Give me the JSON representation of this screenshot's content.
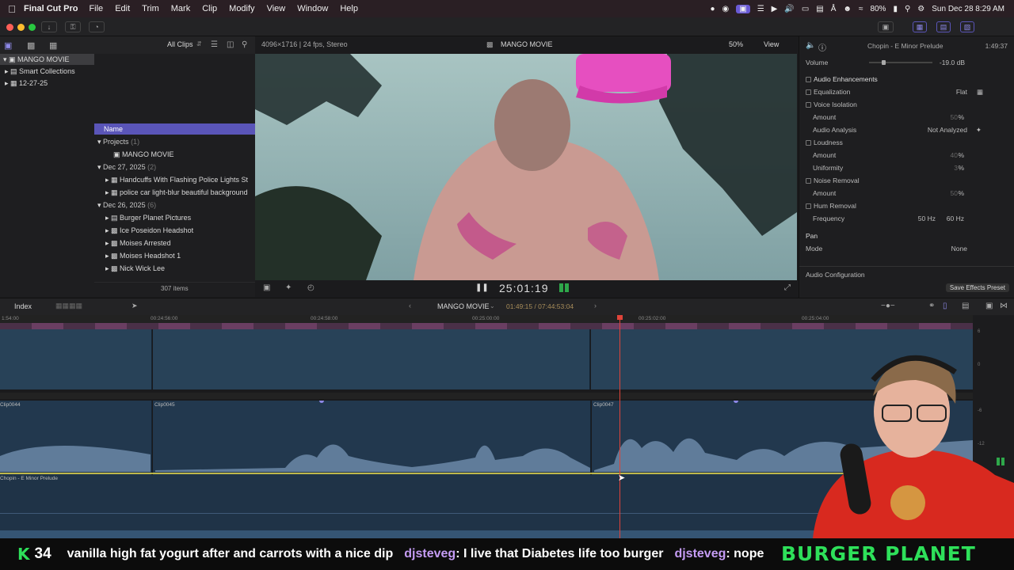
{
  "menubar": {
    "app_name": "Final Cut Pro",
    "items": [
      "File",
      "Edit",
      "Trim",
      "Mark",
      "Clip",
      "Modify",
      "View",
      "Window",
      "Help"
    ],
    "battery": "80%",
    "datetime": "Sun Dec 28  8:29 AM"
  },
  "browser": {
    "library_name": "MANGO MOVIE",
    "sidebar_items": [
      "Smart Collections",
      "12-27-25"
    ],
    "filter_label": "All Clips",
    "column_name": "Name",
    "items_count": "307 items",
    "groups": [
      {
        "label": "Projects",
        "count": "(1)",
        "items": [
          "MANGO MOVIE"
        ]
      },
      {
        "label": "Dec 27, 2025",
        "count": "(2)",
        "items": [
          "Handcuffs With Flashing Police Lights St",
          "police car light-blur beautiful background"
        ]
      },
      {
        "label": "Dec 26, 2025",
        "count": "(6)",
        "items": [
          "Burger Planet Pictures",
          "Ice Poseidon Headshot",
          "Moises Arrested",
          "Moises Headshot 1",
          "Nick Wick Lee"
        ]
      }
    ]
  },
  "viewer": {
    "format_info": "4096×1716 | 24 fps, Stereo",
    "title": "MANGO MOVIE",
    "zoom": "50%",
    "view_label": "View",
    "timecode": "25:01:19"
  },
  "inspector": {
    "clip_title": "Chopin - E Minor Prelude",
    "duration": "1:49:37",
    "volume_label": "Volume",
    "volume_value": "-19.0 dB",
    "section_enhancements": "Audio Enhancements",
    "equalization_label": "Equalization",
    "equalization_value": "Flat",
    "voice_isolation_label": "Voice Isolation",
    "amount_label": "Amount",
    "pct": "%",
    "amount1": "50",
    "audio_analysis_label": "Audio Analysis",
    "audio_analysis_value": "Not Analyzed",
    "loudness_label": "Loudness",
    "amount2": "40",
    "uniformity_label": "Uniformity",
    "uniformity_value": "3",
    "noise_removal_label": "Noise Removal",
    "amount3": "50",
    "hum_removal_label": "Hum Removal",
    "frequency_label": "Frequency",
    "freq_50": "50 Hz",
    "freq_60": "60 Hz",
    "pan_label": "Pan",
    "mode_label": "Mode",
    "mode_value": "None",
    "audio_config_label": "Audio Configuration",
    "save_preset_label": "Save Effects Preset"
  },
  "timeline": {
    "index_label": "Index",
    "project_name": "MANGO MOVIE",
    "duration_text": "01:49:15 / 07:44:53:04",
    "ruler_labels": [
      "1:54:00",
      "00:24:56:00",
      "00:24:58:00",
      "00:25:00:00",
      "00:25:02:00",
      "00:25:04:00"
    ],
    "clip_labels": [
      "Clip0044",
      "Clip0045",
      "Clip0047"
    ],
    "music_label": "Chopin - E Minor Prelude",
    "meter_labels": [
      "6",
      "0",
      "-6",
      "-12"
    ]
  },
  "stream": {
    "counter": "34",
    "chat_text_1": "vanilla high fat yogurt after and carrots with a nice dip",
    "user_1": "djsteveg",
    "chat_text_2": ": I live that Diabetes life too burger",
    "user_2": "djsteveg",
    "chat_text_3": ": nope",
    "brand": "BURGER PLANET"
  },
  "colors": {
    "accent": "#5a55b8",
    "chat_user": "#c59cf4",
    "brand_green": "#2ee05a",
    "playhead": "#e0443a"
  }
}
